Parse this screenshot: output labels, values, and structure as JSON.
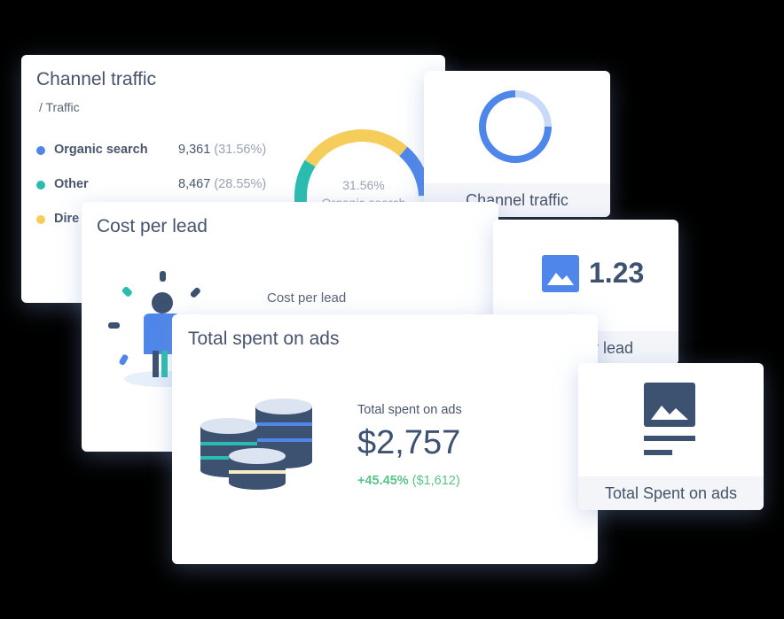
{
  "colors": {
    "blue": "#4f86ea",
    "teal": "#2bbcb0",
    "yellow": "#f5cd5b",
    "green": "#5cc28a",
    "navy": "#3d5170"
  },
  "channel_traffic": {
    "title": "Channel traffic",
    "breadcrumb": "/ Traffic",
    "rows": [
      {
        "label": "Organic search",
        "value": "9,361",
        "percent": "(31.56%)",
        "color": "#4f86ea"
      },
      {
        "label": "Other",
        "value": "8,467",
        "percent": "(28.55%)",
        "color": "#2bbcb0"
      },
      {
        "label": "Dire",
        "value": "",
        "percent": "",
        "color": "#f5cd5b"
      }
    ],
    "donut_center_pct": "31.56%",
    "donut_center_label": "Organic search"
  },
  "widget_channel": {
    "label": "Channel traffic",
    "ring_fraction": 0.85
  },
  "cost_per_lead": {
    "title": "Cost per lead",
    "inner_label": "Cost per lead"
  },
  "widget_cost": {
    "value": "1.23",
    "label": "Cost per lead",
    "icon": "image-icon"
  },
  "total_spent": {
    "title": "Total spent on ads",
    "label": "Total spent on ads",
    "value": "$2,757",
    "change": "+45.45%",
    "change_abs": "($1,612)"
  },
  "widget_total": {
    "label": "Total Spent on ads",
    "icon": "document-image-icon"
  }
}
